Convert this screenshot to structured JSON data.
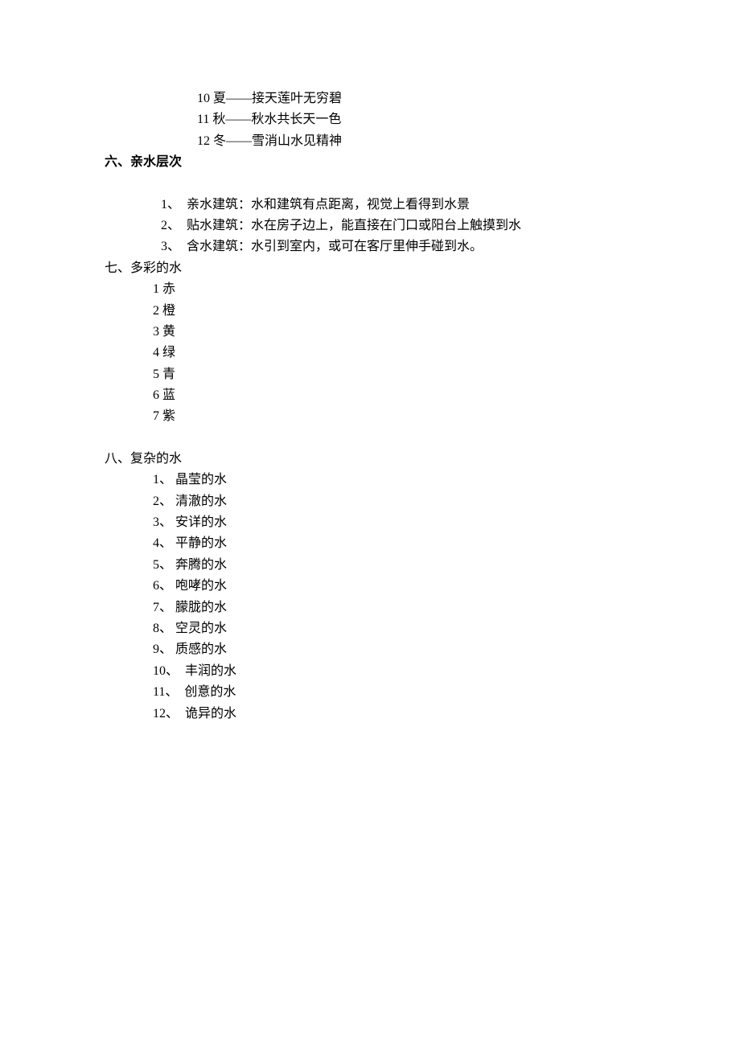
{
  "top_items": [
    "10 夏——接天莲叶无穷碧",
    "11 秋——秋水共长天一色",
    "12 冬——雪消山水见精神"
  ],
  "section6": {
    "heading": "六、亲水层次",
    "items": [
      "1、　亲水建筑：水和建筑有点距离，视觉上看得到水景",
      "2、　贴水建筑：水在房子边上，能直接在门口或阳台上触摸到水",
      "3、　含水建筑：水引到室内，或可在客厅里伸手碰到水。"
    ]
  },
  "section7": {
    "heading": "七、多彩的水",
    "items": [
      "1 赤",
      "2 橙",
      "3 黄",
      "4 绿",
      "5 青",
      "6 蓝",
      "7 紫"
    ]
  },
  "section8": {
    "heading": "八、复杂的水",
    "items": [
      "1、 晶莹的水",
      "2、 清澈的水",
      "3、 安详的水",
      "4、 平静的水",
      "5、 奔腾的水",
      "6、 咆哮的水",
      "7、 朦胧的水",
      "8、 空灵的水",
      "9、 质感的水",
      "10、　丰润的水",
      "11、　创意的水",
      "12、　诡异的水"
    ]
  }
}
